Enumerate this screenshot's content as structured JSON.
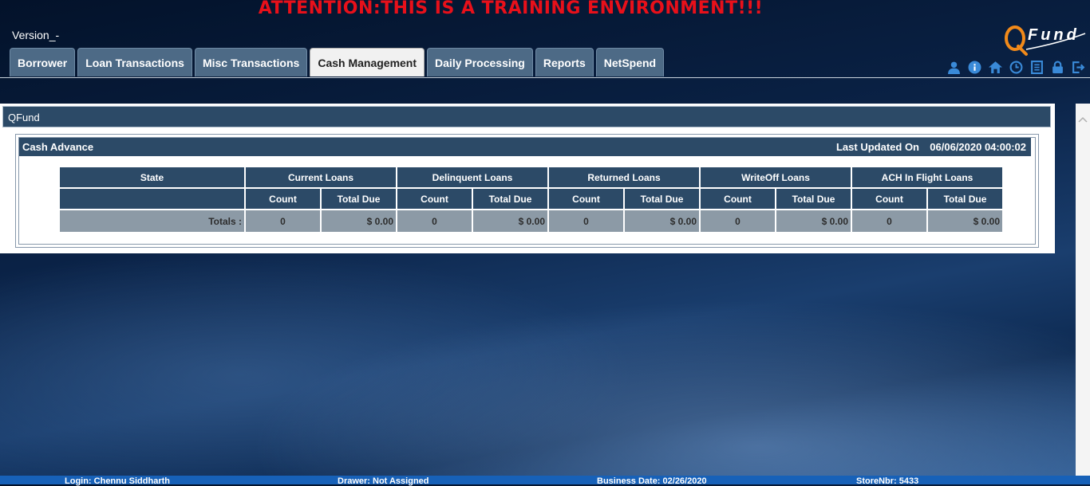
{
  "banner": "ATTENTION:THIS IS A TRAINING ENVIRONMENT!!!",
  "version": "Version_-",
  "logo_text": "Fund",
  "tabs": [
    {
      "label": "Borrower"
    },
    {
      "label": "Loan Transactions"
    },
    {
      "label": "Misc Transactions"
    },
    {
      "label": "Cash Management",
      "active": true
    },
    {
      "label": "Daily Processing"
    },
    {
      "label": "Reports"
    },
    {
      "label": "NetSpend"
    }
  ],
  "toolbar_icons": [
    "user-icon",
    "info-icon",
    "home-icon",
    "clock-icon",
    "calculator-icon",
    "lock-icon",
    "logout-icon"
  ],
  "panel": {
    "title": "QFund",
    "section_title": "Cash Advance",
    "last_updated_label": "Last Updated On",
    "last_updated_value": "06/06/2020 04:00:02"
  },
  "table": {
    "state_header": "State",
    "groups": [
      "Current Loans",
      "Delinquent Loans",
      "Returned Loans",
      "WriteOff Loans",
      "ACH In Flight Loans"
    ],
    "count_label": "Count",
    "total_due_label": "Total Due",
    "totals_label": "Totals :",
    "totals": [
      {
        "count": "0",
        "total_due": "$ 0.00"
      },
      {
        "count": "0",
        "total_due": "$ 0.00"
      },
      {
        "count": "0",
        "total_due": "$ 0.00"
      },
      {
        "count": "0",
        "total_due": "$ 0.00"
      },
      {
        "count": "0",
        "total_due": "$ 0.00"
      }
    ]
  },
  "status_bar": {
    "login": "Login: Chennu Siddharth",
    "drawer": "Drawer: Not Assigned",
    "business_date": "Business Date: 02/26/2020",
    "store": "StoreNbr: 5433"
  },
  "colors": {
    "banner": "#e8101a",
    "header_bg": "#2c4a67",
    "tab_bg": "#4d6a86",
    "status_bg": "#1761b8"
  }
}
